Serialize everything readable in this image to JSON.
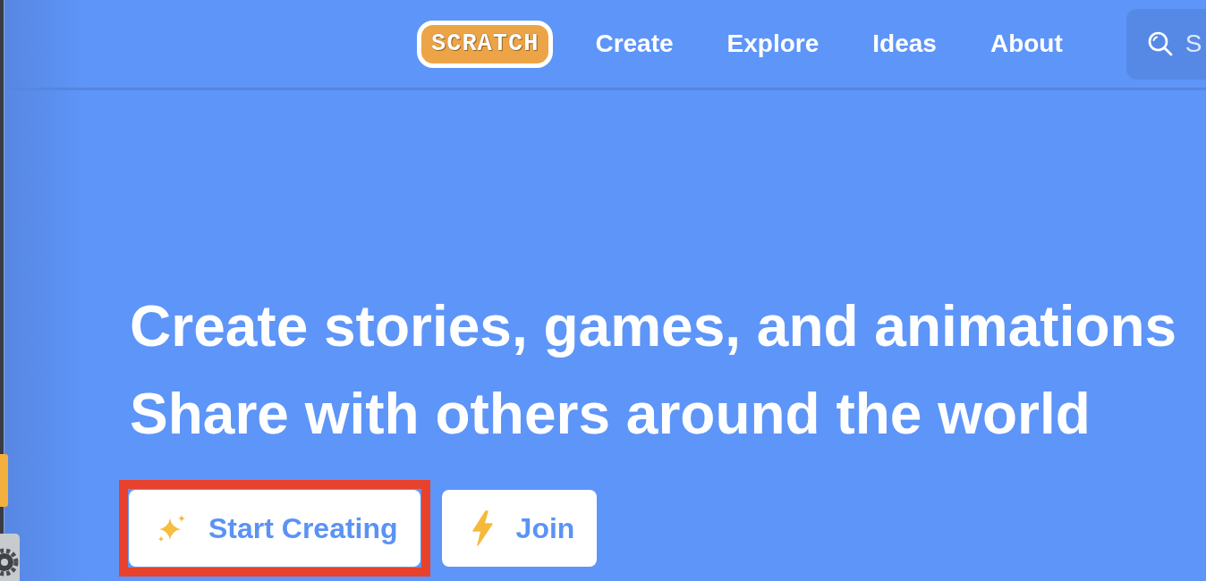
{
  "nav": {
    "logo": "SCRATCH",
    "links": [
      "Create",
      "Explore",
      "Ideas",
      "About"
    ],
    "search": {
      "placeholder": "S"
    }
  },
  "hero": {
    "headline": "Create stories, games, and animations",
    "subheadline": "Share with others around the world"
  },
  "buttons": [
    {
      "label": "Start Creating",
      "kind": "sparkle",
      "highlighted": true
    },
    {
      "label": "Join",
      "kind": "bolt",
      "highlighted": false
    }
  ]
}
